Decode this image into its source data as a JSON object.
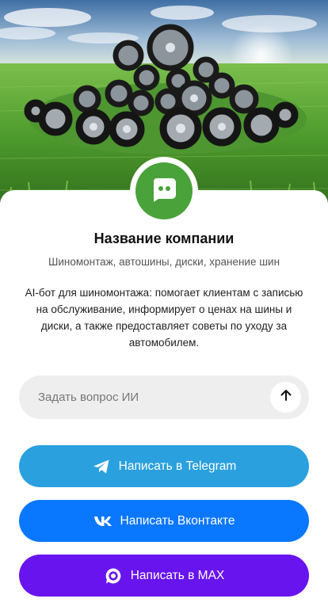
{
  "hero": {
    "image": "tires-in-green-field",
    "colors": {
      "sky_top": "#3f6fa5",
      "sky_horizon": "#dfe8d9",
      "grass_dark": "#2f6b1c",
      "grass_light": "#7bc04a"
    }
  },
  "company": {
    "name": "Название компании",
    "subtitle": "Шиномонтаж, автошины, диски, хранение шин",
    "description": "AI-бот для шиномонтажа: помогает клиентам с записью на обслуживание, информирует о ценах на шины и диски, а также предоставляет советы по уходу за автомобилем.",
    "avatar_icon": "chat-bot-icon",
    "avatar_color": "#4aa23a"
  },
  "ask": {
    "placeholder": "Задать вопрос ИИ",
    "value": "",
    "send_icon": "arrow-up-icon"
  },
  "buttons": [
    {
      "label": "Написать в Telegram",
      "icon": "telegram-icon",
      "color": "#2aa0df"
    },
    {
      "label": "Написать Вконтакте",
      "icon": "vk-icon",
      "color": "#0a77ff"
    },
    {
      "label": "Написать в MAX",
      "icon": "max-icon",
      "color": "#6814ee"
    }
  ]
}
